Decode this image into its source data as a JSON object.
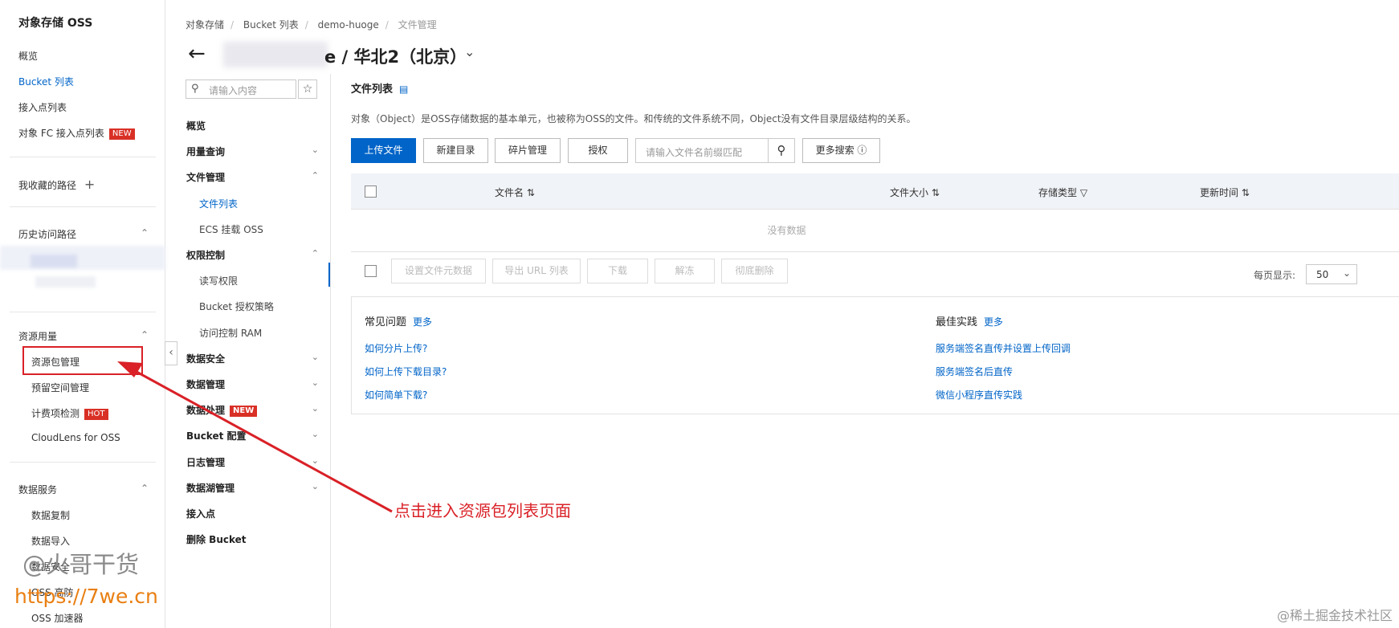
{
  "sidebar": {
    "title": "对象存储 OSS",
    "items": [
      {
        "label": "概览"
      },
      {
        "label": "Bucket 列表"
      },
      {
        "label": "接入点列表"
      },
      {
        "label": "对象 FC 接入点列表",
        "badge": "NEW"
      }
    ],
    "favorites_label": "我收藏的路径",
    "favorites_add": "+",
    "history_label": "历史访问路径",
    "resource_section": "资源用量",
    "resource_items": [
      {
        "label": "资源包管理"
      },
      {
        "label": "预留空间管理"
      },
      {
        "label": "计费项检测",
        "badge": "HOT"
      },
      {
        "label": "CloudLens for OSS"
      }
    ],
    "data_service_section": "数据服务",
    "data_service_items": [
      {
        "label": "数据复制"
      },
      {
        "label": "数据导入"
      },
      {
        "label": "数据安全"
      },
      {
        "label": "OSS 高防"
      },
      {
        "label": "OSS 加速器"
      }
    ]
  },
  "subnav": {
    "search_placeholder": "请输入内容",
    "star": "☆",
    "items": [
      {
        "label": "概览",
        "type": "top"
      },
      {
        "label": "用量查询",
        "type": "top",
        "chevron": "⌄"
      },
      {
        "label": "文件管理",
        "type": "top",
        "chevron": "⌃"
      },
      {
        "label": "文件列表",
        "type": "sub",
        "active": true
      },
      {
        "label": "ECS 挂载 OSS",
        "type": "sub"
      },
      {
        "label": "权限控制",
        "type": "top",
        "chevron": "⌃"
      },
      {
        "label": "读写权限",
        "type": "sub"
      },
      {
        "label": "Bucket 授权策略",
        "type": "sub"
      },
      {
        "label": "访问控制 RAM",
        "type": "sub"
      },
      {
        "label": "数据安全",
        "type": "top",
        "chevron": "⌄"
      },
      {
        "label": "数据管理",
        "type": "top",
        "chevron": "⌄"
      },
      {
        "label": "数据处理",
        "type": "top",
        "chevron": "⌄",
        "badge": "NEW"
      },
      {
        "label": "Bucket 配置",
        "type": "top",
        "chevron": "⌄"
      },
      {
        "label": "日志管理",
        "type": "top",
        "chevron": "⌄"
      },
      {
        "label": "数据湖管理",
        "type": "top",
        "chevron": "⌄"
      },
      {
        "label": "接入点",
        "type": "top"
      },
      {
        "label": "删除 Bucket",
        "type": "top"
      }
    ]
  },
  "header": {
    "breadcrumb": [
      "对象存储",
      "Bucket 列表",
      "demo-huoge",
      "文件管理"
    ],
    "title": "e / 华北2（北京）",
    "back": "←",
    "dropdown": "⌄"
  },
  "main": {
    "section_title": "文件列表",
    "doc_icon": "▤",
    "description": "对象（Object）是OSS存储数据的基本单元，也被称为OSS的文件。和传统的文件系统不同，Object没有文件目录层级结构的关系。",
    "toolbar": {
      "upload": "上传文件",
      "new_dir": "新建目录",
      "fragments": "碎片管理",
      "authorize": "授权",
      "search_placeholder": "请输入文件名前缀匹配",
      "more_search": "更多搜索 ⓘ"
    },
    "table": {
      "columns": [
        "文件名 ⇅",
        "文件大小 ⇅",
        "存储类型 ▽",
        "更新时间 ⇅"
      ],
      "empty_text": "没有数据"
    },
    "bulk_actions": [
      "设置文件元数据",
      "导出 URL 列表",
      "下载",
      "解冻",
      "彻底删除"
    ],
    "per_page_label": "每页显示:",
    "per_page_value": "50",
    "faq": {
      "title": "常见问题",
      "more": "更多",
      "links": [
        "如何分片上传?",
        "如何上传下载目录?",
        "如何简单下载?"
      ]
    },
    "best_practice": {
      "title": "最佳实践",
      "more": "更多",
      "links": [
        "服务端签名直传并设置上传回调",
        "服务端签名后直传",
        "微信小程序直传实践"
      ]
    }
  },
  "annotation": {
    "text": "点击进入资源包列表页面",
    "color": "#d92127"
  },
  "watermarks": {
    "author": "@火哥干货",
    "url": "https://7we.cn",
    "platform": "@稀土掘金技术社区"
  },
  "colors": {
    "primary": "#0064c8",
    "badge_red": "#d93026",
    "annotation_red": "#d92127"
  }
}
